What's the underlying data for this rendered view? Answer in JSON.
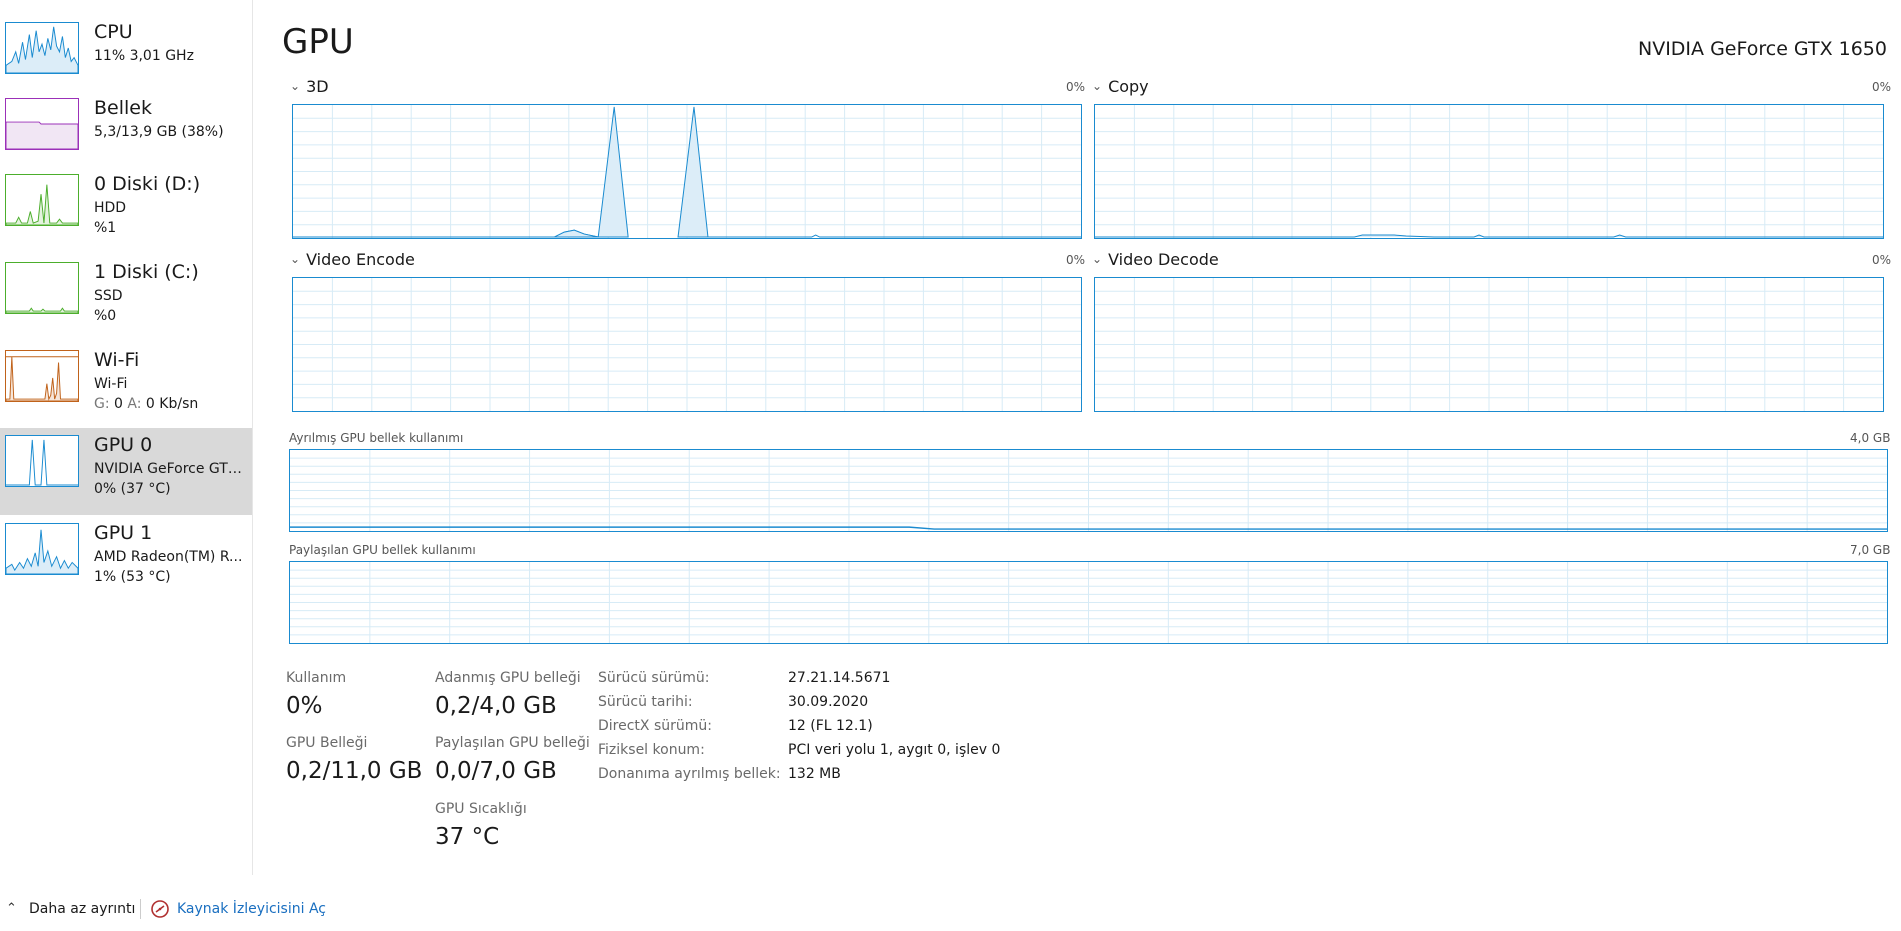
{
  "sidebar": {
    "items": [
      {
        "title": "CPU",
        "line1": "11%  3,01 GHz",
        "line2": "",
        "color": "#1a8bd0"
      },
      {
        "title": "Bellek",
        "line1": "5,3/13,9 GB (38%)",
        "line2": "",
        "color": "#9b30b8"
      },
      {
        "title": "0 Diski (D:)",
        "line1": "HDD",
        "line2": "%1",
        "color": "#4cae2c"
      },
      {
        "title": "1 Diski (C:)",
        "line1": "SSD",
        "line2": "%0",
        "color": "#4cae2c"
      },
      {
        "title": "Wi-Fi",
        "line1": "Wi-Fi",
        "line2_prefix_g": "G:",
        "line2_g": "0",
        "line2_prefix_a": "A:",
        "line2_a": "0 Kb/sn",
        "color": "#c0621a"
      },
      {
        "title": "GPU 0",
        "line1": "NVIDIA GeForce GTX...",
        "line2": "0%  (37 °C)",
        "color": "#1a8bd0",
        "selected": true
      },
      {
        "title": "GPU 1",
        "line1": "AMD Radeon(TM) R...",
        "line2": "1%  (53 °C)",
        "color": "#1a8bd0"
      }
    ]
  },
  "header": {
    "title": "GPU",
    "device_name": "NVIDIA GeForce GTX 1650"
  },
  "engines": [
    {
      "label": "3D",
      "percent": "0%"
    },
    {
      "label": "Copy",
      "percent": "0%"
    },
    {
      "label": "Video Encode",
      "percent": "0%"
    },
    {
      "label": "Video Decode",
      "percent": "0%"
    }
  ],
  "memory_graphs": {
    "dedicated": {
      "label": "Ayrılmış GPU bellek kullanımı",
      "max": "4,0 GB"
    },
    "shared": {
      "label": "Paylaşılan GPU bellek kullanımı",
      "max": "7,0 GB"
    }
  },
  "stats": {
    "utilization": {
      "label": "Kullanım",
      "value": "0%"
    },
    "dedicated": {
      "label": "Adanmış GPU belleği",
      "value": "0,2/4,0 GB"
    },
    "gpu_memory": {
      "label": "GPU Belleği",
      "value": "0,2/11,0 GB"
    },
    "shared": {
      "label": "Paylaşılan GPU belleği",
      "value": "0,0/7,0 GB"
    },
    "temperature": {
      "label": "GPU Sıcaklığı",
      "value": "37 °C"
    }
  },
  "info": {
    "driver_version_label": "Sürücü sürümü:",
    "driver_version": "27.21.14.5671",
    "driver_date_label": "Sürücü tarihi:",
    "driver_date": "30.09.2020",
    "directx_label": "DirectX sürümü:",
    "directx": "12 (FL 12.1)",
    "location_label": "Fiziksel konum:",
    "location": "PCI veri yolu 1, aygıt 0, işlev 0",
    "reserved_label": "Donanıma ayrılmış bellek:",
    "reserved": "132 MB"
  },
  "footer": {
    "fewer_details": "Daha az ayrıntı",
    "open_monitor": "Kaynak İzleyicisini Aç"
  },
  "colors": {
    "accent": "#1a8bd0",
    "grid": "#d7ebf6",
    "link": "#1a6fc0",
    "selected_bg": "#d9d9d9"
  }
}
